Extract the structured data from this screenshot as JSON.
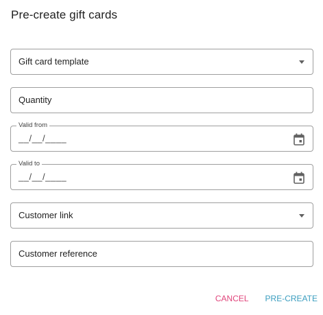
{
  "dialog": {
    "title": "Pre-create gift cards"
  },
  "fields": {
    "template": {
      "placeholder": "Gift card template",
      "icon": "chevron-down-icon"
    },
    "quantity": {
      "placeholder": "Quantity"
    },
    "valid_from": {
      "label": "Valid from",
      "value": "__/__/____",
      "icon": "calendar-icon"
    },
    "valid_to": {
      "label": "Valid to",
      "value": "__/__/____",
      "icon": "calendar-icon"
    },
    "customer_link": {
      "placeholder": "Customer link",
      "icon": "chevron-down-icon"
    },
    "customer_reference": {
      "placeholder": "Customer reference"
    }
  },
  "actions": {
    "cancel_label": "CANCEL",
    "submit_label": "PRE-CREATE"
  },
  "colors": {
    "cancel": "#e0457b",
    "primary": "#3a9dbf",
    "border": "#9e9e9e"
  }
}
